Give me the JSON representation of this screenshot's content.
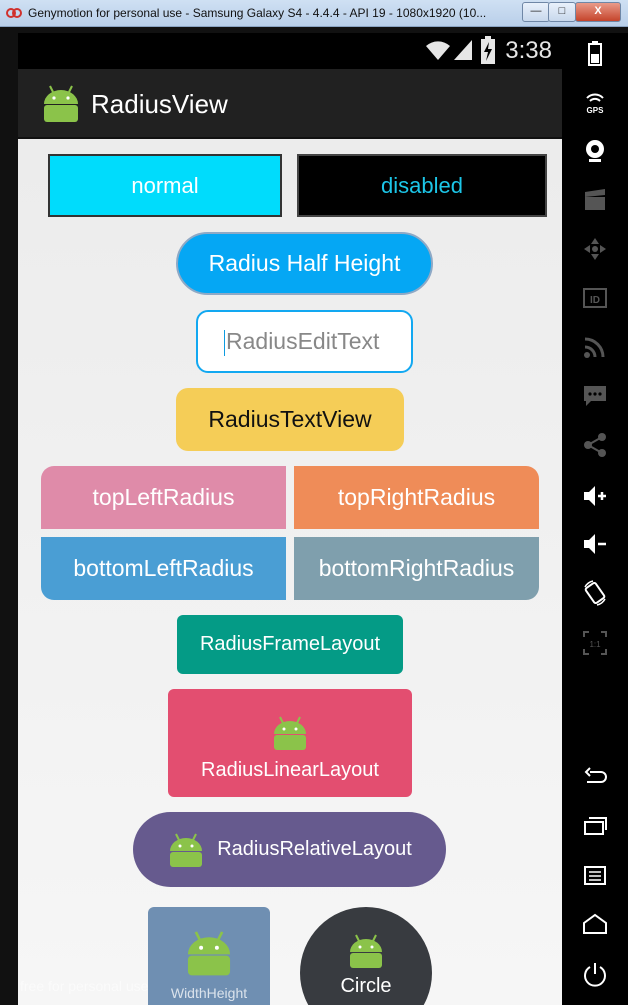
{
  "window": {
    "title": "Genymotion for personal use - Samsung Galaxy S4 - 4.4.4 - API 19 - 1080x1920 (10...",
    "buttons": {
      "minimize": "—",
      "maximize": "□",
      "close": "X"
    }
  },
  "statusbar": {
    "time": "3:38"
  },
  "actionbar": {
    "title": "RadiusView"
  },
  "content": {
    "normal_button": "normal",
    "disabled_button": "disabled",
    "half_height_button": "Radius Half Height",
    "edittext_hint": "RadiusEditText",
    "textview": "RadiusTextView",
    "top_left_radius": "topLeftRadius",
    "top_right_radius": "topRightRadius",
    "bottom_left_radius": "bottomLeftRadius",
    "bottom_right_radius": "bottomRightRadius",
    "frame_layout": "RadiusFrameLayout",
    "linear_layout": "RadiusLinearLayout",
    "relative_layout": "RadiusRelativeLayout",
    "width_height_label": "WidthHeight",
    "circle_label": "Circle"
  },
  "watermark": "free for personal use",
  "sidebar": {
    "icons": [
      "battery-icon",
      "gps-icon",
      "webcam-icon",
      "video-capture-icon",
      "dpad-icon",
      "device-id-icon",
      "cast-icon",
      "sms-icon",
      "share-icon",
      "volume-up-icon",
      "volume-down-icon",
      "rotate-icon",
      "pixel-perfect-icon",
      "back-icon",
      "recent-apps-icon",
      "menu-icon",
      "home-icon",
      "power-icon"
    ],
    "gps_label": "GPS",
    "id_label": "ID",
    "scale_label": "1:1"
  },
  "colors": {
    "normal": "#00dcfc",
    "disabled_text": "#1cc6e8",
    "half_height": "#05a7f4",
    "textview": "#f5cd57",
    "top_left": "#df8ba9",
    "top_right": "#ef8c58",
    "bottom_left": "#4a9ed4",
    "bottom_right": "#7f9fad",
    "frame_layout": "#049b86",
    "linear_layout": "#e34e70",
    "relative_layout": "#665a8e",
    "width_height": "#6f8fb2",
    "circle": "#383b40",
    "android_green": "#8bc34a"
  }
}
